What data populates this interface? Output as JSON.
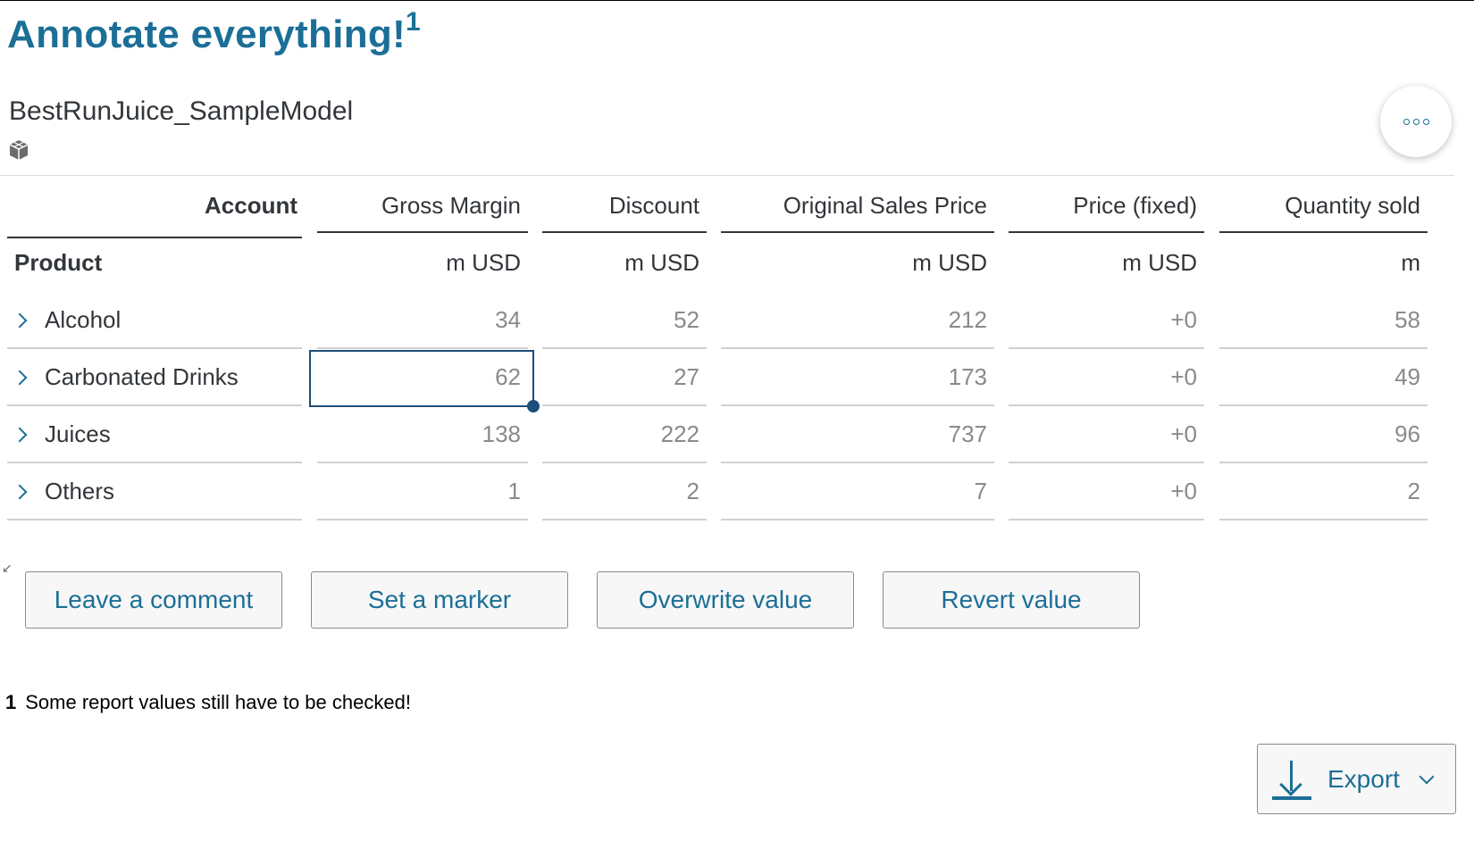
{
  "title": "Annotate everything!",
  "title_footnote_ref": "1",
  "model_name": "BestRunJuice_SampleModel",
  "table": {
    "account_header": "Account",
    "product_header": "Product",
    "columns": [
      {
        "label": "Gross Margin",
        "unit": "m USD"
      },
      {
        "label": "Discount",
        "unit": "m USD"
      },
      {
        "label": "Original Sales Price",
        "unit": "m USD"
      },
      {
        "label": "Price (fixed)",
        "unit": "m USD"
      },
      {
        "label": "Quantity sold",
        "unit": "m"
      }
    ],
    "rows": [
      {
        "label": "Alcohol",
        "values": [
          "34",
          "52",
          "212",
          "+0",
          "58"
        ]
      },
      {
        "label": "Carbonated Drinks",
        "values": [
          "62",
          "27",
          "173",
          "+0",
          "49"
        ]
      },
      {
        "label": "Juices",
        "values": [
          "138",
          "222",
          "737",
          "+0",
          "96"
        ]
      },
      {
        "label": "Others",
        "values": [
          "1",
          "2",
          "7",
          "+0",
          "2"
        ]
      }
    ]
  },
  "actions": {
    "comment": "Leave a comment",
    "marker": "Set a marker",
    "overwrite": "Overwrite value",
    "revert": "Revert value"
  },
  "footnote": {
    "number": "1",
    "text": "Some report values still have to be checked!"
  },
  "export_label": "Export",
  "colors": {
    "accent": "#1b6f97",
    "selection": "#1b4f7a"
  },
  "icons": {
    "model": "cube-icon",
    "more": "more-options-icon",
    "expand": "chevron-right-icon",
    "export": "download-icon",
    "dropdown": "chevron-down-icon"
  }
}
